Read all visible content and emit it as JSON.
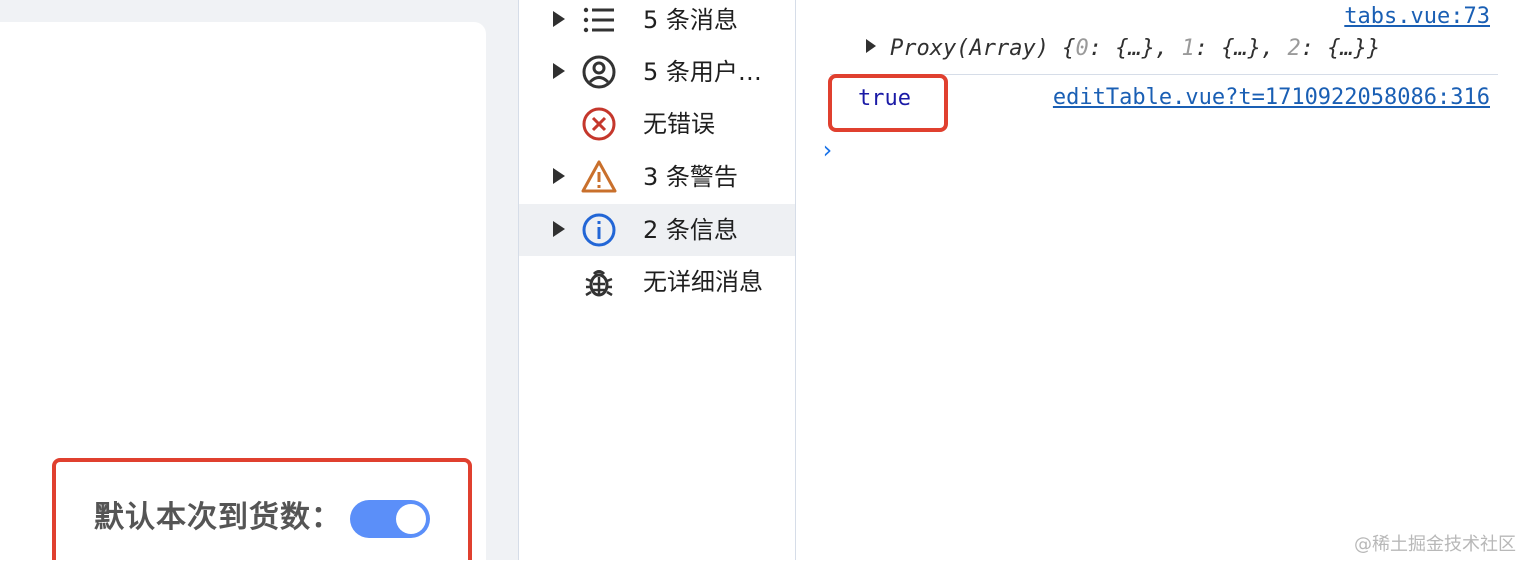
{
  "form": {
    "label": "默认本次到货数：",
    "switch_on": true,
    "switch_color": "#5b8ff9"
  },
  "sidebar": {
    "items": [
      {
        "label": "5 条消息",
        "icon": "list-icon",
        "expandable": true,
        "selected": false
      },
      {
        "label": "5 条用户…",
        "icon": "user-icon",
        "expandable": true,
        "selected": false
      },
      {
        "label": "无错误",
        "icon": "error-icon",
        "expandable": false,
        "selected": false
      },
      {
        "label": "3 条警告",
        "icon": "warning-icon",
        "expandable": true,
        "selected": false
      },
      {
        "label": "2 条信息",
        "icon": "info-icon",
        "expandable": true,
        "selected": true
      },
      {
        "label": "无详细消息",
        "icon": "bug-icon",
        "expandable": false,
        "selected": false
      }
    ]
  },
  "console": {
    "entry1": {
      "source": "tabs.vue:73",
      "prefix": "Proxy(Array) {",
      "items": [
        {
          "index": "0",
          "value": "{…}"
        },
        {
          "index": "1",
          "value": "{…}"
        },
        {
          "index": "2",
          "value": "{…}"
        }
      ],
      "suffix": "}"
    },
    "entry2": {
      "value": "true",
      "source": "editTable.vue?t=1710922058086:316"
    },
    "prompt": "›"
  },
  "colors": {
    "highlight": "#e0402f",
    "link": "#1a5fb4",
    "boolean": "#1a1aa6"
  },
  "watermark": "@稀土掘金技术社区"
}
